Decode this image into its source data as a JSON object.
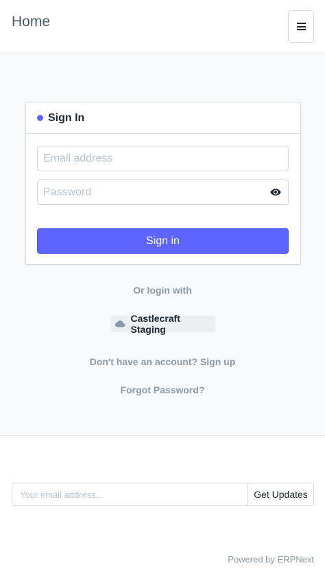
{
  "navbar": {
    "brand": "Home",
    "menu_icon": "hamburger-menu-icon"
  },
  "login": {
    "title": "Sign In",
    "indicator_color": "#5e64ff",
    "email_placeholder": "Email address",
    "password_placeholder": "Password",
    "password_toggle_icon": "eye-icon",
    "submit_label": "Sign in",
    "accent_color": "#5e64ff"
  },
  "social": {
    "or_label": "Or login with",
    "provider_icon": "cloud-icon",
    "provider_label": "Castlecraft Staging"
  },
  "links": {
    "signup": "Don't have an account? Sign up",
    "forgot": "Forgot Password?"
  },
  "footer": {
    "subscribe_placeholder": "Your email address...",
    "subscribe_button": "Get Updates",
    "powered_prefix": "Powered by",
    "powered_brand": "ERPNext"
  }
}
